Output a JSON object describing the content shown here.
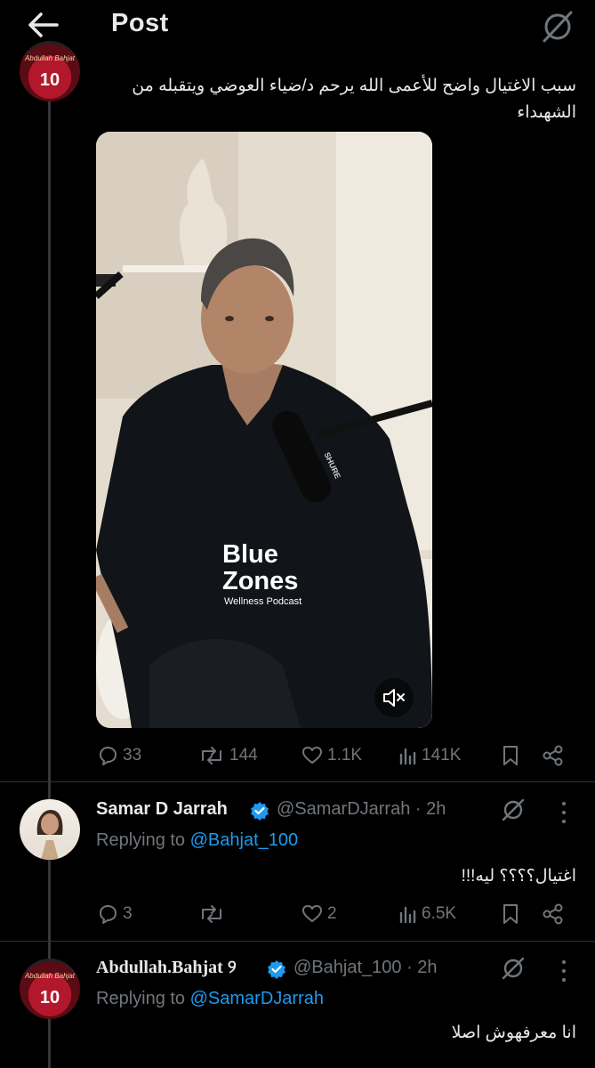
{
  "header": {
    "title": "Post"
  },
  "main_post": {
    "text": "سبب الاغتيال واضح للأعمى الله يرحم د/ضياء العوضي ويتقبله من الشهىداء",
    "avatar": {
      "number": "10",
      "caption": "Abdullah Bahjat"
    },
    "video": {
      "brand_line1": "Blue",
      "brand_line2": "Zones",
      "brand_sub": "Wellness Podcast",
      "mic_label": "SHURE"
    },
    "actions": {
      "replies": "33",
      "reposts": "144",
      "likes": "1.1K",
      "views": "141K"
    }
  },
  "replies": [
    {
      "name": "Samar D Jarrah",
      "handle": "@SamarDJarrah",
      "time": "· 2h",
      "replying_label": "Replying to",
      "replying_to": "@Bahjat_100",
      "text": "اغتيال؟؟؟؟ ليه!!!",
      "actions": {
        "replies": "3",
        "reposts": "",
        "likes": "2",
        "views": "6.5K"
      }
    },
    {
      "name": "Abdullah.Bahjat",
      "name_suffix": "୨",
      "handle": "@Bahjat_100",
      "time": "· 2h",
      "replying_label": "Replying to",
      "replying_to": "@SamarDJarrah",
      "text": "انا معرفهوش اصلا",
      "avatar": {
        "number": "10",
        "caption": "Abdullah Bahjat"
      }
    }
  ],
  "colors": {
    "accent": "#1d9bf0",
    "muted": "#71767b",
    "text": "#e7e9ea",
    "background": "#000000",
    "verified": "#1d9bf0"
  }
}
